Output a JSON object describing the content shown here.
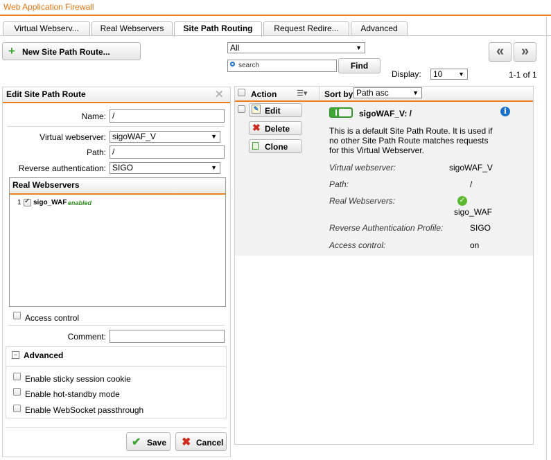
{
  "app": {
    "title": "Web Application Firewall"
  },
  "tabs": [
    {
      "label": "Virtual Webserv..."
    },
    {
      "label": "Real Webservers"
    },
    {
      "label": "Site Path Routing"
    },
    {
      "label": "Request Redire..."
    },
    {
      "label": "Advanced"
    }
  ],
  "toolbar": {
    "new_button": "New Site Path Route...",
    "filter_value": "All",
    "search_placeholder": "search",
    "find_button": "Find",
    "display_label": "Display:",
    "display_value": "10",
    "pager_prev": "«",
    "pager_next": "»",
    "range": "1-1 of 1"
  },
  "edit_panel": {
    "title": "Edit Site Path Route",
    "name_label": "Name:",
    "name_value": "/",
    "vws_label": "Virtual webserver:",
    "vws_value": "sigoWAF_V",
    "path_label": "Path:",
    "path_value": "/",
    "revauth_label": "Reverse authentication:",
    "revauth_value": "SIGO",
    "real_ws_title": "Real Webservers",
    "real_ws_items": [
      {
        "index": "1",
        "name": "sigo_WAF",
        "status": "enabled"
      }
    ],
    "access_control_label": "Access control",
    "comment_label": "Comment:",
    "comment_value": "",
    "advanced_title": "Advanced",
    "advanced_toggle": "−",
    "advanced_options": [
      "Enable sticky session cookie",
      "Enable hot-standby mode",
      "Enable WebSocket passthrough"
    ],
    "save_button": "Save",
    "cancel_button": "Cancel"
  },
  "list": {
    "action_header": "Action",
    "sortby_label": "Sort by:",
    "sortby_value": "Path asc",
    "actions": {
      "edit": "Edit",
      "delete": "Delete",
      "clone": "Clone"
    },
    "item": {
      "title": "sigoWAF_V: /",
      "description": "This is a default Site Path Route. It is used if no other Site Path Route matches requests for this Virtual Webserver.",
      "fields": [
        {
          "label": "Virtual webserver:",
          "value": "sigoWAF_V"
        },
        {
          "label": "Path:",
          "value": "/"
        },
        {
          "label": "Real Webservers:",
          "value": "sigo_WAF"
        },
        {
          "label": "Reverse Authentication Profile:",
          "value": "SIGO"
        },
        {
          "label": "Access control:",
          "value": "on"
        }
      ]
    }
  },
  "colors": {
    "accent": "#f07e1b",
    "toggle_green": "#3fa535",
    "info_blue": "#1a73c9",
    "enabled_green": "#2e8b1f"
  }
}
